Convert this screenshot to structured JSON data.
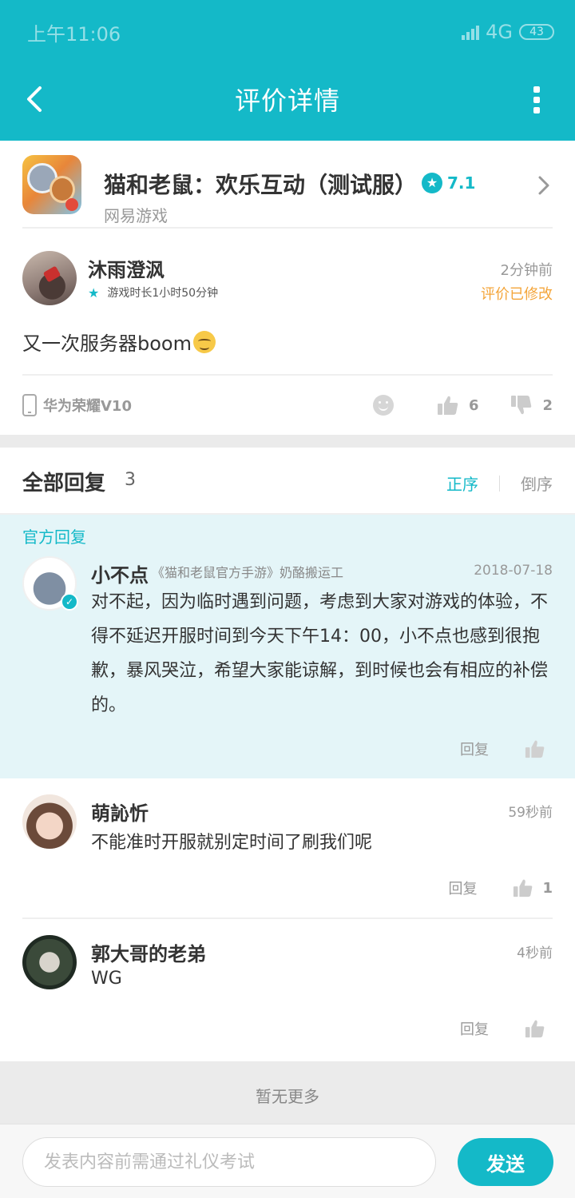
{
  "status_bar": {
    "time": "上午11:06",
    "network": "4G",
    "battery": "43"
  },
  "header": {
    "title": "评价详情",
    "back_icon": "chevron-left-icon",
    "more_icon": "more-vertical-icon"
  },
  "game": {
    "name": "猫和老鼠：欢乐互动（测试服）",
    "rating": "7.1",
    "publisher": "网易游戏"
  },
  "review": {
    "user": "沐雨澄沨",
    "play_time": "游戏时长1小时50分钟",
    "time": "2分钟前",
    "modified": "评价已修改",
    "text": "又一次服务器boom",
    "device": "华为荣耀V10",
    "likes": "6",
    "dislikes": "2"
  },
  "replies": {
    "title": "全部回复",
    "count": "3",
    "sort_asc": "正序",
    "sort_desc": "倒序",
    "official_label": "官方回复",
    "official": {
      "user": "小不点",
      "tag": "《猫和老鼠官方手游》奶酪搬运工",
      "date": "2018-07-18",
      "text": "对不起，因为临时遇到问题，考虑到大家对游戏的体验，不得不延迟开服时间到今天下午14：00，小不点也感到很抱歉，暴风哭泣，希望大家能谅解，到时候也会有相应的补偿的。",
      "reply_label": "回复"
    },
    "items": [
      {
        "user": "萌訫忻",
        "time": "59秒前",
        "text": "不能准时开服就别定时间了刷我们呢",
        "reply_label": "回复",
        "likes": "1"
      },
      {
        "user": "郭大哥的老弟",
        "time": "4秒前",
        "text": "WG",
        "reply_label": "回复"
      }
    ],
    "no_more": "暂无更多"
  },
  "composer": {
    "placeholder": "发表内容前需通过礼仪考试",
    "send_label": "发送"
  },
  "colors": {
    "accent": "#14b9c8",
    "warning": "#f4a53a"
  }
}
